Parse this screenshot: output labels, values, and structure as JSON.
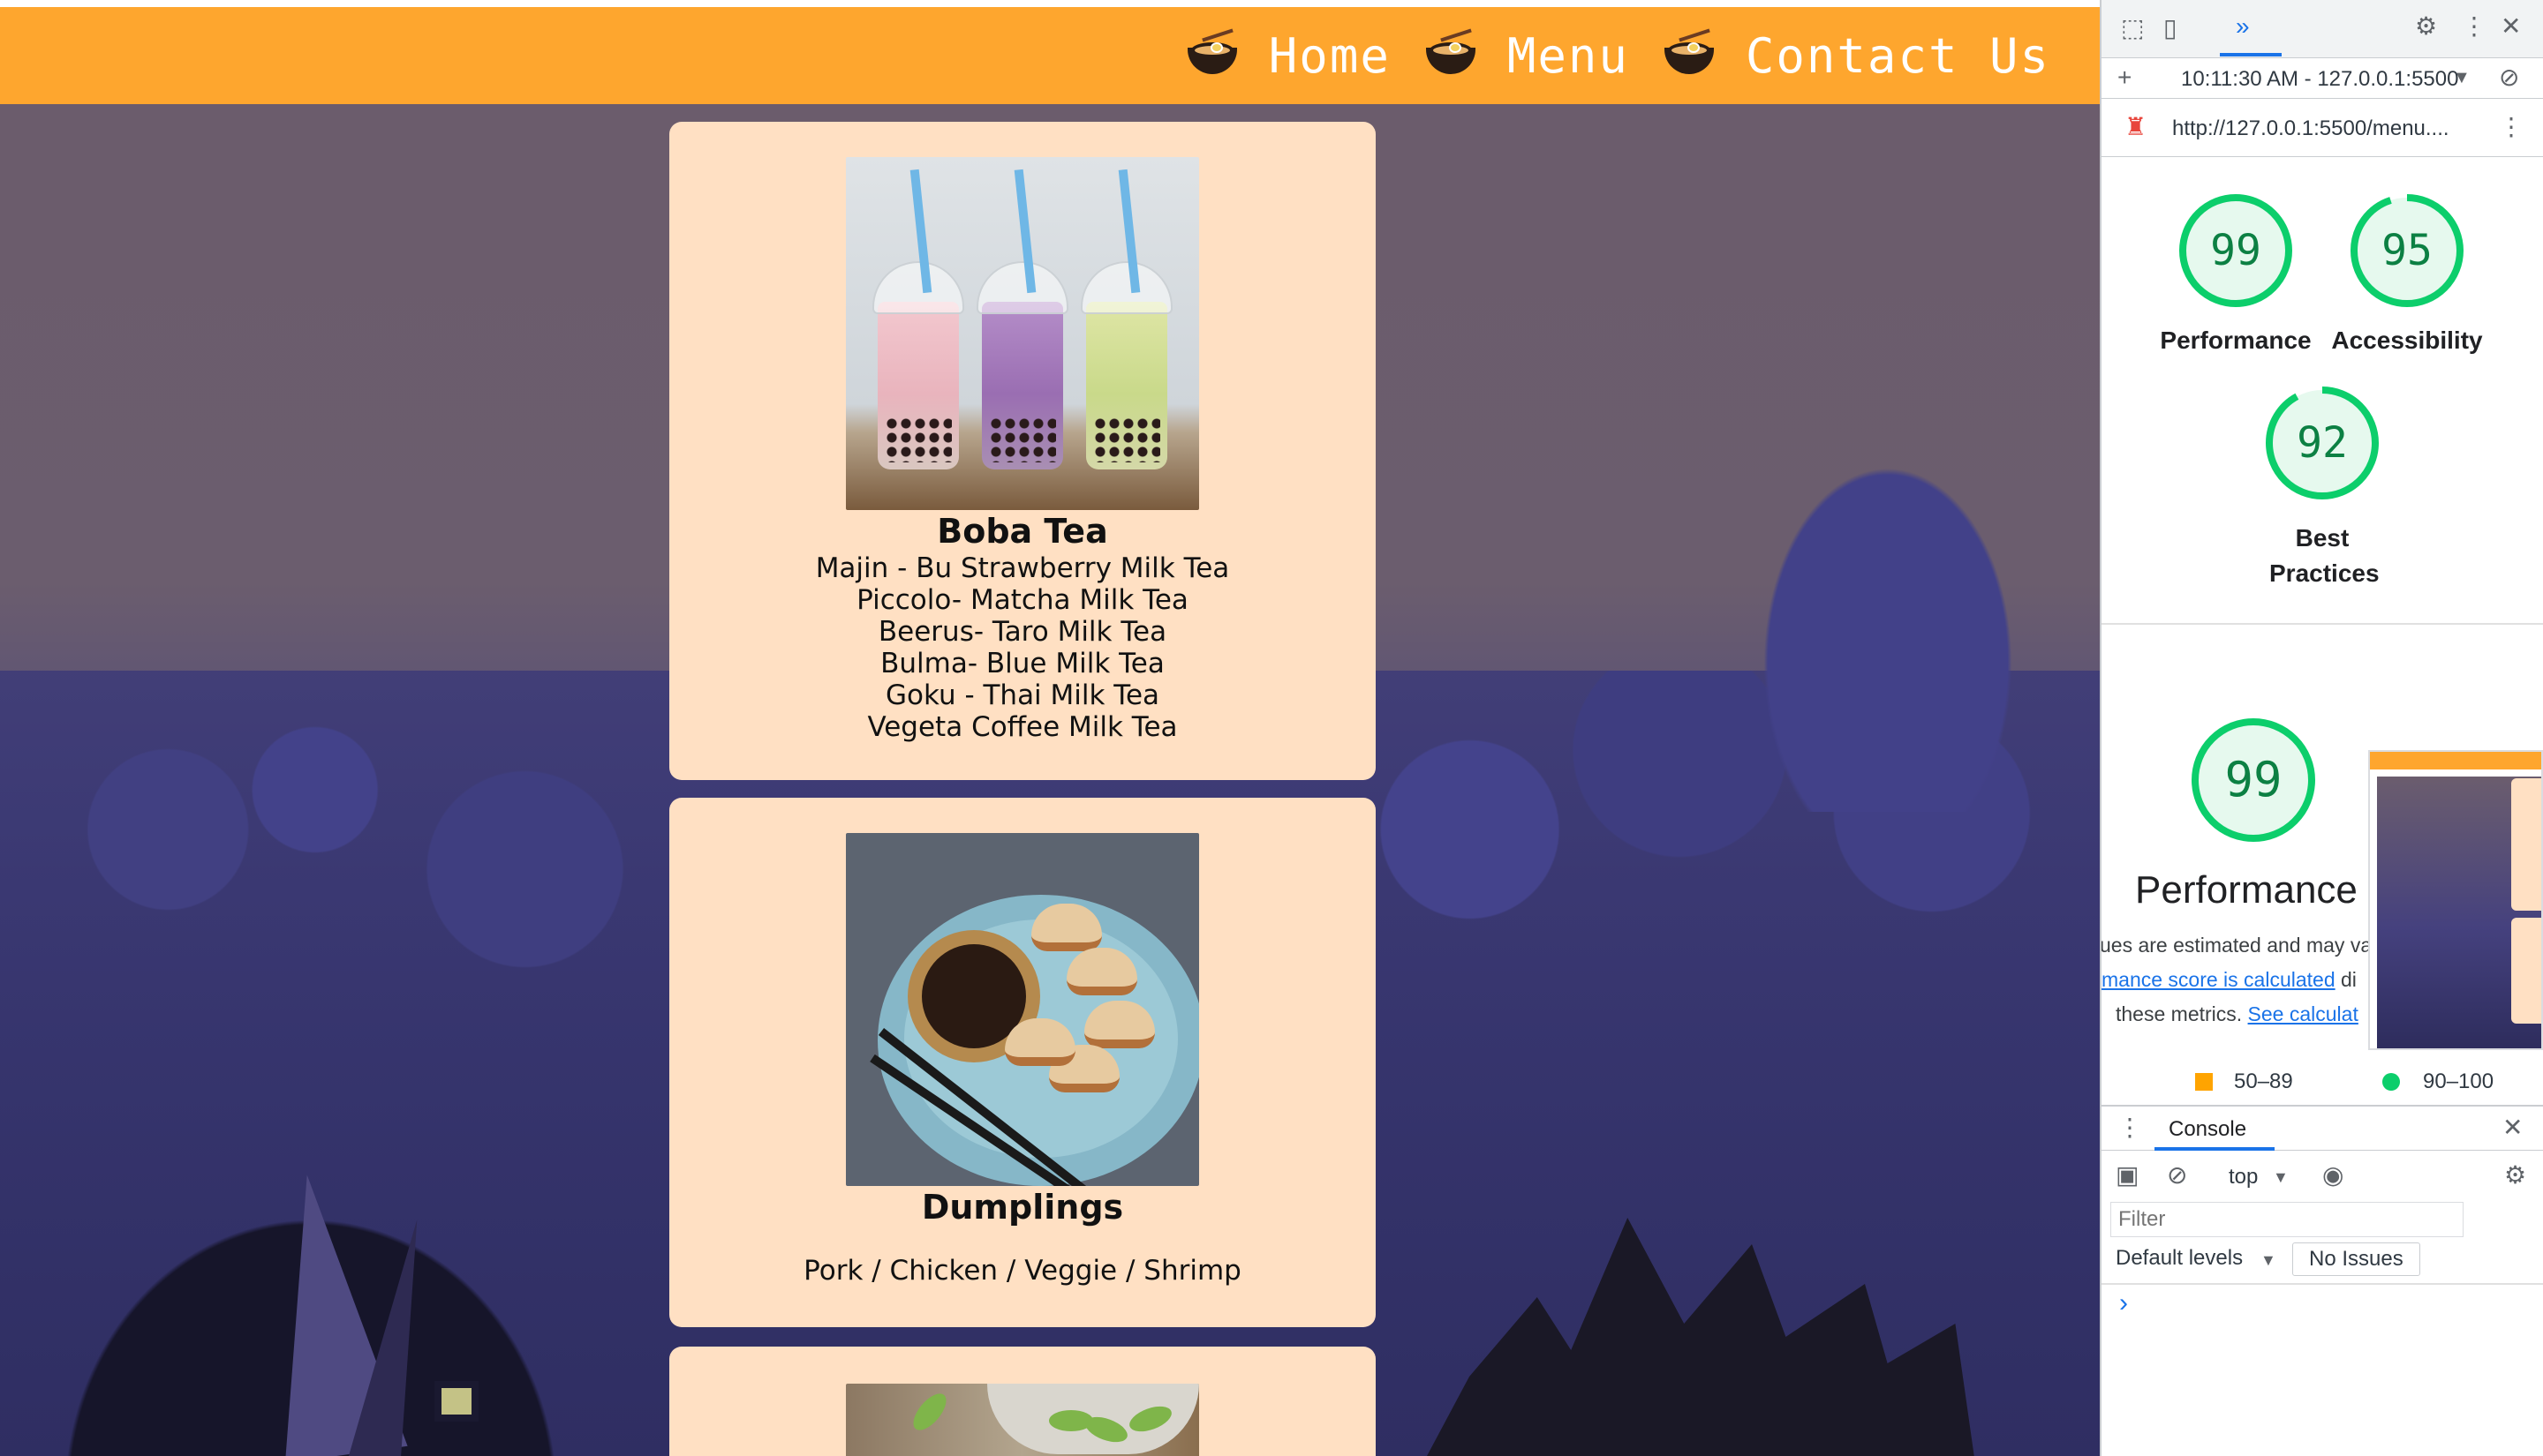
{
  "header": {
    "nav": [
      {
        "label": "Home",
        "icon": "ramen-bowl-icon"
      },
      {
        "label": "Menu",
        "icon": "ramen-bowl-icon"
      },
      {
        "label": "Contact Us",
        "icon": "ramen-bowl-icon"
      }
    ],
    "background_color": "#fea62e",
    "text_color": "#ffffff"
  },
  "cards": [
    {
      "title": "Boba Tea",
      "items": [
        "Majin - Bu Strawberry Milk Tea",
        "Piccolo- Matcha Milk Tea",
        "Beerus- Taro Milk Tea",
        "Bulma- Blue Milk Tea",
        "Goku - Thai Milk Tea",
        "Vegeta Coffee Milk Tea"
      ]
    },
    {
      "title": "Dumplings",
      "items": [
        "Pork / Chicken / Veggie / Shrimp"
      ]
    },
    {
      "title": "",
      "items": []
    }
  ],
  "card_background": "#ffe0c3",
  "devtools": {
    "timestamp_url": "10:11:30 AM - 127.0.0.1:5500",
    "page_url": "http://127.0.0.1:5500/menu....",
    "scores": [
      {
        "value": "99",
        "label": "Performance"
      },
      {
        "value": "95",
        "label": "Accessibility"
      },
      {
        "value": "92",
        "label": "Best Practices"
      }
    ],
    "performance_detail": {
      "value": "99",
      "title": "Performance",
      "text_line1": "ues are estimated and may va",
      "link_line2": "mance score is calculated",
      "text_line2_tail": "di",
      "text_line3": "these metrics.",
      "link_line3": "See calculat"
    },
    "legend": [
      {
        "range": "50–89",
        "color": "#ffa400"
      },
      {
        "range": "90–100",
        "color": "#0cce6b"
      }
    ],
    "console": {
      "tab_label": "Console",
      "context": "top",
      "filter_placeholder": "Filter",
      "levels": "Default levels",
      "issues": "No Issues",
      "prompt": "›"
    },
    "good_color": "#0cce6b"
  }
}
